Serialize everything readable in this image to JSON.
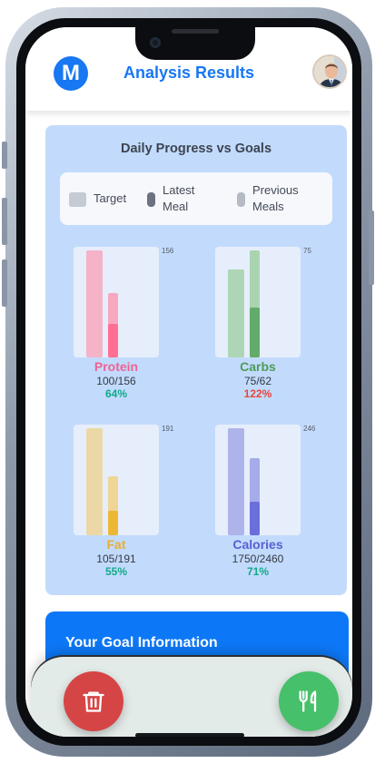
{
  "header": {
    "logo_letter": "M",
    "title": "Analysis Results"
  },
  "progress": {
    "title": "Daily Progress vs Goals",
    "legend": [
      {
        "line1": "Target",
        "line2": "",
        "color": "#c5cad4"
      },
      {
        "line1": "Latest",
        "line2": "Meal",
        "color": "#6b7280"
      },
      {
        "line1": "Previous",
        "line2": "Meals",
        "color": "#b5bac4"
      }
    ],
    "macros": [
      {
        "name": "Protein",
        "max_label": "156",
        "ratio": "100/156",
        "percent": "64%",
        "name_color": "#f06292",
        "percent_color": "#14a889",
        "target_fraction": 1.0,
        "previous_fraction": 0.6,
        "latest_fraction": 0.31,
        "target_color": "#f5b3c8",
        "previous_color": "#f7a8bf",
        "latest_color": "#ff6f93"
      },
      {
        "name": "Carbs",
        "max_label": "75",
        "ratio": "75/62",
        "percent": "122%",
        "name_color": "#4e9c58",
        "percent_color": "#e8453c",
        "target_fraction": 0.82,
        "previous_fraction": 1.0,
        "latest_fraction": 0.47,
        "target_color": "#aed6b6",
        "previous_color": "#a9d4af",
        "latest_color": "#62ac6b"
      },
      {
        "name": "Fat",
        "max_label": "191",
        "ratio": "105/191",
        "percent": "55%",
        "name_color": "#e9ad33",
        "percent_color": "#14a889",
        "target_fraction": 1.0,
        "previous_fraction": 0.55,
        "latest_fraction": 0.23,
        "target_color": "#ebd8a6",
        "previous_color": "#efd596",
        "latest_color": "#ebb734"
      },
      {
        "name": "Calories",
        "max_label": "246",
        "ratio": "1750/2460",
        "percent": "71%",
        "name_color": "#5a5fd0",
        "percent_color": "#14a889",
        "target_fraction": 1.0,
        "previous_fraction": 0.72,
        "latest_fraction": 0.31,
        "target_color": "#aeb4ea",
        "previous_color": "#a6abea",
        "latest_color": "#6b6fdc"
      }
    ]
  },
  "goal": {
    "title": "Your Goal Information"
  },
  "actions": {
    "delete_icon": "trash-icon",
    "delete_color": "#d64545",
    "log_icon": "fork-knife-icon",
    "log_color": "#46c06a"
  }
}
